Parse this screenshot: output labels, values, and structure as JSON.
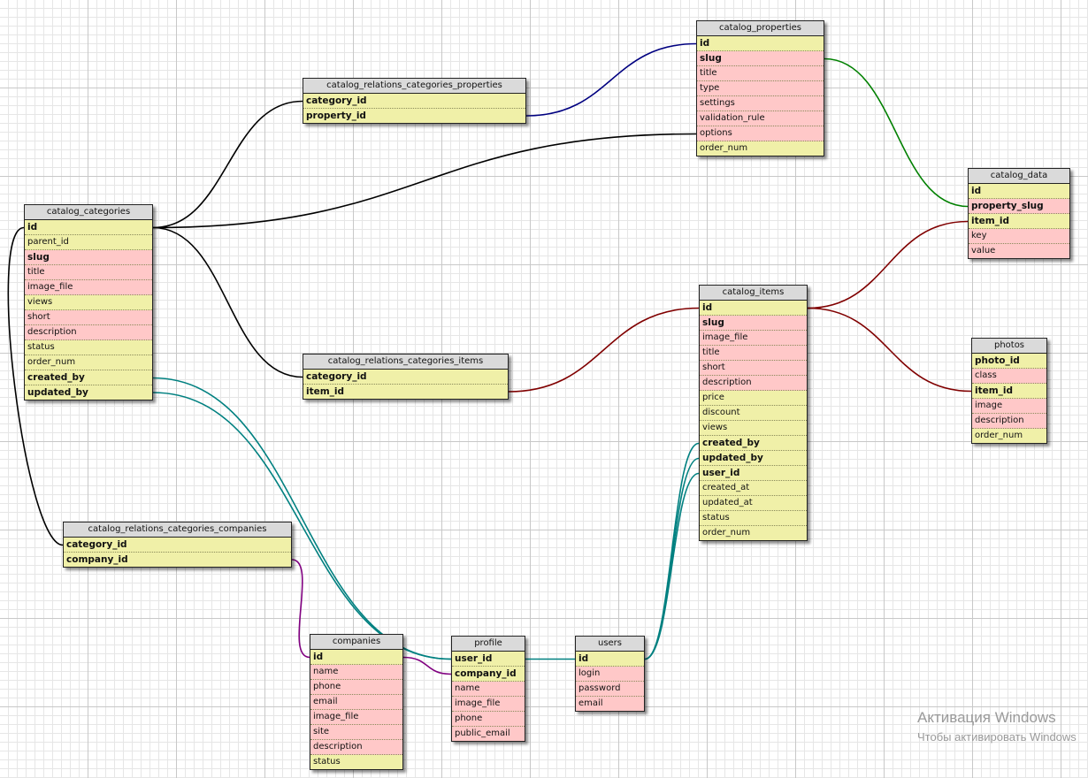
{
  "tables": {
    "catalog_categories": {
      "title": "catalog_categories",
      "fields": [
        {
          "name": "id",
          "key": true,
          "hl": "y"
        },
        {
          "name": "parent_id",
          "key": false,
          "hl": "y"
        },
        {
          "name": "slug",
          "key": true,
          "hl": "p"
        },
        {
          "name": "title",
          "key": false,
          "hl": "p"
        },
        {
          "name": "image_file",
          "key": false,
          "hl": "p"
        },
        {
          "name": "views",
          "key": false,
          "hl": "y"
        },
        {
          "name": "short",
          "key": false,
          "hl": "p"
        },
        {
          "name": "description",
          "key": false,
          "hl": "p"
        },
        {
          "name": "status",
          "key": false,
          "hl": "y"
        },
        {
          "name": "order_num",
          "key": false,
          "hl": "y"
        },
        {
          "name": "created_by",
          "key": true,
          "hl": "y"
        },
        {
          "name": "updated_by",
          "key": true,
          "hl": "y"
        }
      ]
    },
    "catalog_relations_categories_properties": {
      "title": "catalog_relations_categories_properties",
      "fields": [
        {
          "name": "category_id",
          "key": true,
          "hl": "y"
        },
        {
          "name": "property_id",
          "key": true,
          "hl": "y"
        }
      ]
    },
    "catalog_properties": {
      "title": "catalog_properties",
      "fields": [
        {
          "name": "id",
          "key": true,
          "hl": "y"
        },
        {
          "name": "slug",
          "key": true,
          "hl": "p"
        },
        {
          "name": "title",
          "key": false,
          "hl": "p"
        },
        {
          "name": "type",
          "key": false,
          "hl": "p"
        },
        {
          "name": "settings",
          "key": false,
          "hl": "p"
        },
        {
          "name": "validation_rule",
          "key": false,
          "hl": "p"
        },
        {
          "name": "options",
          "key": false,
          "hl": "p"
        },
        {
          "name": "order_num",
          "key": false,
          "hl": "y"
        }
      ]
    },
    "catalog_data": {
      "title": "catalog_data",
      "fields": [
        {
          "name": "id",
          "key": true,
          "hl": "y"
        },
        {
          "name": "property_slug",
          "key": true,
          "hl": "p"
        },
        {
          "name": "item_id",
          "key": true,
          "hl": "y"
        },
        {
          "name": "key",
          "key": false,
          "hl": "p"
        },
        {
          "name": "value",
          "key": false,
          "hl": "p"
        }
      ]
    },
    "catalog_items": {
      "title": "catalog_items",
      "fields": [
        {
          "name": "id",
          "key": true,
          "hl": "y"
        },
        {
          "name": "slug",
          "key": true,
          "hl": "p"
        },
        {
          "name": "image_file",
          "key": false,
          "hl": "p"
        },
        {
          "name": "title",
          "key": false,
          "hl": "p"
        },
        {
          "name": "short",
          "key": false,
          "hl": "p"
        },
        {
          "name": "description",
          "key": false,
          "hl": "p"
        },
        {
          "name": "price",
          "key": false,
          "hl": "y"
        },
        {
          "name": "discount",
          "key": false,
          "hl": "y"
        },
        {
          "name": "views",
          "key": false,
          "hl": "y"
        },
        {
          "name": "created_by",
          "key": true,
          "hl": "y"
        },
        {
          "name": "updated_by",
          "key": true,
          "hl": "y"
        },
        {
          "name": "user_id",
          "key": true,
          "hl": "y"
        },
        {
          "name": "created_at",
          "key": false,
          "hl": "y"
        },
        {
          "name": "updated_at",
          "key": false,
          "hl": "y"
        },
        {
          "name": "status",
          "key": false,
          "hl": "y"
        },
        {
          "name": "order_num",
          "key": false,
          "hl": "y"
        }
      ]
    },
    "catalog_relations_categories_items": {
      "title": "catalog_relations_categories_items",
      "fields": [
        {
          "name": "category_id",
          "key": true,
          "hl": "y"
        },
        {
          "name": "item_id",
          "key": true,
          "hl": "y"
        }
      ]
    },
    "photos": {
      "title": "photos",
      "fields": [
        {
          "name": "photo_id",
          "key": true,
          "hl": "y"
        },
        {
          "name": "class",
          "key": false,
          "hl": "p"
        },
        {
          "name": "item_id",
          "key": true,
          "hl": "y"
        },
        {
          "name": "image",
          "key": false,
          "hl": "p"
        },
        {
          "name": "description",
          "key": false,
          "hl": "p"
        },
        {
          "name": "order_num",
          "key": false,
          "hl": "y"
        }
      ]
    },
    "catalog_relations_categories_companies": {
      "title": "catalog_relations_categories_companies",
      "fields": [
        {
          "name": "category_id",
          "key": true,
          "hl": "y"
        },
        {
          "name": "company_id",
          "key": true,
          "hl": "y"
        }
      ]
    },
    "companies": {
      "title": "companies",
      "fields": [
        {
          "name": "id",
          "key": true,
          "hl": "y"
        },
        {
          "name": "name",
          "key": false,
          "hl": "p"
        },
        {
          "name": "phone",
          "key": false,
          "hl": "p"
        },
        {
          "name": "email",
          "key": false,
          "hl": "p"
        },
        {
          "name": "image_file",
          "key": false,
          "hl": "p"
        },
        {
          "name": "site",
          "key": false,
          "hl": "p"
        },
        {
          "name": "description",
          "key": false,
          "hl": "p"
        },
        {
          "name": "status",
          "key": false,
          "hl": "y"
        }
      ]
    },
    "profile": {
      "title": "profile",
      "fields": [
        {
          "name": "user_id",
          "key": true,
          "hl": "y"
        },
        {
          "name": "company_id",
          "key": true,
          "hl": "y"
        },
        {
          "name": "name",
          "key": false,
          "hl": "p"
        },
        {
          "name": "image_file",
          "key": false,
          "hl": "p"
        },
        {
          "name": "phone",
          "key": false,
          "hl": "p"
        },
        {
          "name": "public_email",
          "key": false,
          "hl": "p"
        }
      ]
    },
    "users": {
      "title": "users",
      "fields": [
        {
          "name": "id",
          "key": true,
          "hl": "y"
        },
        {
          "name": "login",
          "key": false,
          "hl": "p"
        },
        {
          "name": "password",
          "key": false,
          "hl": "p"
        },
        {
          "name": "email",
          "key": false,
          "hl": "p"
        }
      ]
    }
  },
  "relations": [
    {
      "from": "catalog_categories.id",
      "to": "catalog_relations_categories_properties.category_id",
      "color": "#000000"
    },
    {
      "from": "catalog_categories.id",
      "to": "catalog_properties.options",
      "color": "#000000"
    },
    {
      "from": "catalog_categories.id",
      "to": "catalog_relations_categories_items.category_id",
      "color": "#000000"
    },
    {
      "from": "catalog_categories.id",
      "to": "catalog_relations_categories_companies.category_id",
      "color": "#000000"
    },
    {
      "from": "catalog_relations_categories_properties.property_id",
      "to": "catalog_properties.id",
      "color": "#000080"
    },
    {
      "from": "catalog_properties.slug",
      "to": "catalog_data.property_slug",
      "color": "#008000"
    },
    {
      "from": "catalog_items.id",
      "to": "catalog_data.item_id",
      "color": "#800000"
    },
    {
      "from": "catalog_items.id",
      "to": "photos.item_id",
      "color": "#800000"
    },
    {
      "from": "catalog_relations_categories_items.item_id",
      "to": "catalog_items.id",
      "color": "#800000"
    },
    {
      "from": "catalog_relations_categories_companies.company_id",
      "to": "companies.id",
      "color": "#800080"
    },
    {
      "from": "companies.id",
      "to": "profile.company_id",
      "color": "#800080"
    },
    {
      "from": "catalog_categories.created_by",
      "to": "profile.user_id",
      "color": "#008080"
    },
    {
      "from": "catalog_categories.updated_by",
      "to": "profile.user_id",
      "color": "#008080"
    },
    {
      "from": "profile.user_id",
      "to": "users.id",
      "color": "#008080"
    },
    {
      "from": "users.id",
      "to": "catalog_items.created_by",
      "color": "#008080"
    },
    {
      "from": "users.id",
      "to": "catalog_items.updated_by",
      "color": "#008080"
    },
    {
      "from": "users.id",
      "to": "catalog_items.user_id",
      "color": "#008080"
    }
  ],
  "watermark": {
    "line1": "Активация Windows",
    "line2": "Чтобы активировать Windows"
  }
}
